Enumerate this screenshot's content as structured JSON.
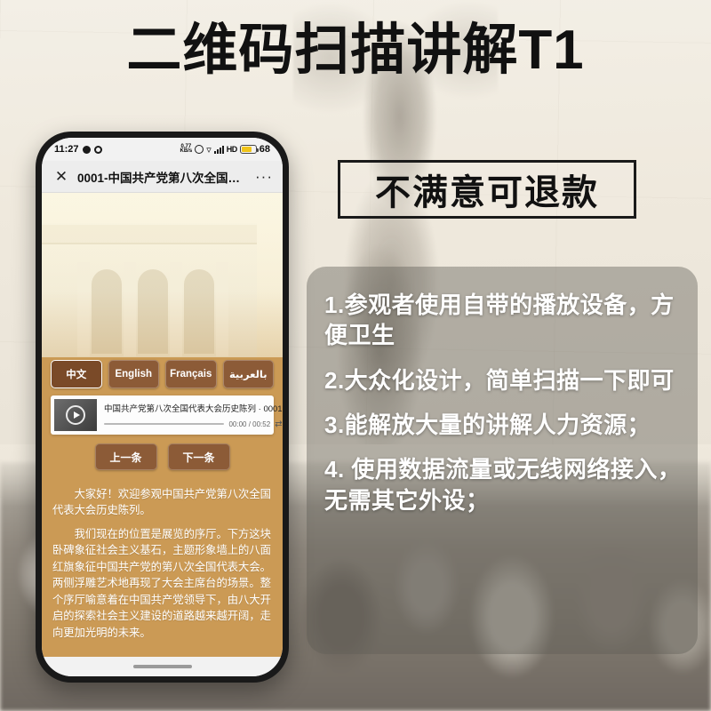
{
  "poster": {
    "headline": "二维码扫描讲解T1",
    "refund_badge": "不满意可退款",
    "features": [
      "1.参观者使用自带的播放设备，方便卫生",
      "2.大众化设计，简单扫描一下即可",
      "3.能解放大量的讲解人力资源；",
      "4. 使用数据流量或无线网络接入，无需其它外设；"
    ]
  },
  "phone": {
    "statusbar": {
      "time": "11:27",
      "data_speed": "0.77\nKB/s",
      "hd_label": "HD",
      "battery_level": "68",
      "icons": [
        "alarm-icon",
        "wifi-icon",
        "signal-icon",
        "hd-icon",
        "battery-icon"
      ]
    },
    "header": {
      "close_label": "✕",
      "title": "0001-中国共产党第八次全国代表大...",
      "more_label": "···"
    },
    "languages": [
      {
        "label": "中文",
        "selected": true
      },
      {
        "label": "English",
        "selected": false
      },
      {
        "label": "Français",
        "selected": false
      },
      {
        "label": "بالعربية",
        "selected": false
      }
    ],
    "player": {
      "title": "中国共产党第八次全国代表大会历史陈列 · 0001",
      "time": "00:00 / 00:52",
      "loop_icon": "⇄"
    },
    "nav": {
      "prev_label": "上一条",
      "next_label": "下一条"
    },
    "article": {
      "p1": "大家好！欢迎参观中国共产党第八次全国代表大会历史陈列。",
      "p2": "我们现在的位置是展览的序厅。下方这块卧碑象征社会主义基石，主题形象墙上的八面红旗象征中国共产党的第八次全国代表大会。两侧浮雕艺术地再现了大会主席台的场景。整个序厅喻意着在中国共产党领导下，由八大开启的探索社会主义建设的道路越来越开阔，走向更加光明的未来。"
    }
  },
  "colors": {
    "accent_brown": "#8c5b37",
    "panel_bg": "#cb9a55",
    "battery_yellow": "#f0c419",
    "headline_black": "#111111"
  }
}
